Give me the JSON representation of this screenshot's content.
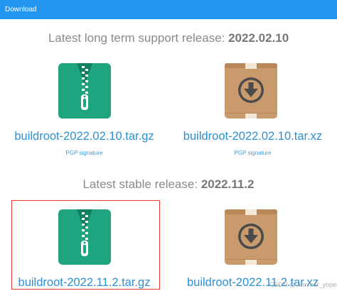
{
  "window": {
    "title": "Download"
  },
  "lts": {
    "heading_prefix": "Latest long term support release:",
    "version": "2022.02.10",
    "gz_label": "buildroot-2022.02.10.tar.gz",
    "xz_label": "buildroot-2022.02.10.tar.xz",
    "gz_pgp": "PGP signature",
    "xz_pgp": "PGP signature"
  },
  "stable": {
    "heading_prefix": "Latest stable release:",
    "version": "2022.11.2",
    "gz_label": "buildroot-2022.11.2.tar.gz",
    "xz_label": "buildroot-2022.11.2.tar.xz"
  },
  "icons": {
    "gz": "zip-archive-icon",
    "xz": "package-box-download-icon"
  },
  "colors": {
    "titlebar": "#2196f3",
    "link": "#2b8fd6",
    "zip_green": "#1aa784",
    "box_brown": "#c8996b",
    "highlight": "#e53935"
  },
  "watermark": "CSDN @Jammer_yoper"
}
